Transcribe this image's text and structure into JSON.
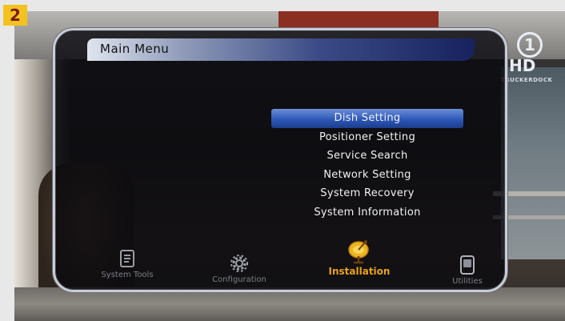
{
  "badge": {
    "number": "2"
  },
  "channel_logo": {
    "number": "1",
    "hd": "HD",
    "caption": "TRUCKERDOCK"
  },
  "menu": {
    "title": "Main Menu",
    "items": [
      {
        "label": "Dish Setting",
        "selected": true
      },
      {
        "label": "Positioner Setting",
        "selected": false
      },
      {
        "label": "Service Search",
        "selected": false
      },
      {
        "label": "Network Setting",
        "selected": false
      },
      {
        "label": "System Recovery",
        "selected": false
      },
      {
        "label": "System Information",
        "selected": false
      }
    ]
  },
  "tabs": [
    {
      "label": "System Tools",
      "icon": "clipboard-icon",
      "active": false
    },
    {
      "label": "Configuration",
      "icon": "gear-icon",
      "active": false
    },
    {
      "label": "Installation",
      "icon": "satellite-dish-icon",
      "active": true
    },
    {
      "label": "Utilities",
      "icon": "device-icon",
      "active": false
    }
  ],
  "colors": {
    "selection": "#2e58b8",
    "active_tab": "#e7a21a",
    "inactive_tab": "#7d8087",
    "badge": "#f4c21e"
  }
}
